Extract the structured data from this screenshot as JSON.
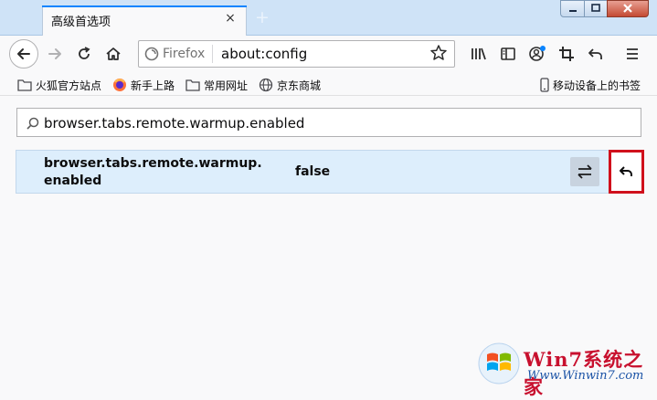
{
  "tab": {
    "title": "高级首选项",
    "close": "×",
    "new_tab": "+"
  },
  "toolbar": {
    "identity_label": "Firefox",
    "url": "about:config"
  },
  "bookmarks": [
    {
      "icon": "folder-icon",
      "label": "火狐官方站点"
    },
    {
      "icon": "firefox-icon",
      "label": "新手上路"
    },
    {
      "icon": "folder-icon",
      "label": "常用网址"
    },
    {
      "icon": "globe-icon",
      "label": "京东商城"
    },
    {
      "icon": "mobile-icon",
      "label": "移动设备上的书签"
    }
  ],
  "config": {
    "search_value": "browser.tabs.remote.warmup.enabled",
    "pref": {
      "name": "browser.tabs.remote.warmup.enabled",
      "value": "false"
    }
  },
  "watermark": {
    "brand": "Win7系统之家",
    "url": "Www.Winwin7.com"
  },
  "colors": {
    "accent": "#0a84ff",
    "highlight_border": "#d0101c",
    "row_bg": "#ddeefc"
  }
}
